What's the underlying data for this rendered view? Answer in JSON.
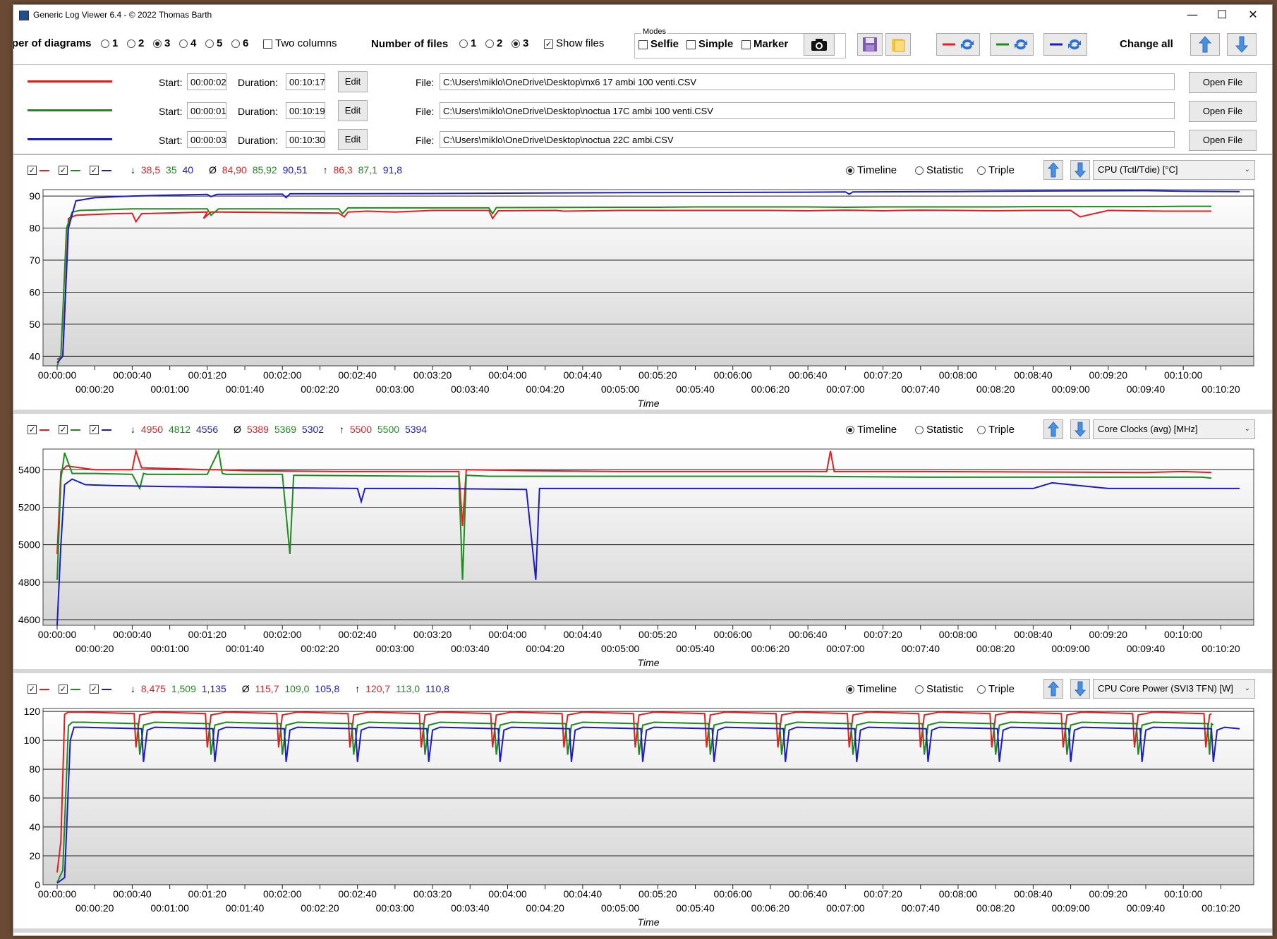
{
  "window": {
    "title": "Generic Log Viewer 6.4 - © 2022 Thomas Barth",
    "minimize": "—",
    "maximize": "☐",
    "close": "✕"
  },
  "toolbar": {
    "diagrams_label": "per of diagrams",
    "diagram_options": [
      "1",
      "2",
      "3",
      "4",
      "5",
      "6"
    ],
    "diagram_selected": "3",
    "two_columns_label": "Two columns",
    "files_label": "Number of files",
    "file_options": [
      "1",
      "2",
      "3"
    ],
    "file_selected": "3",
    "show_files_label": "Show files",
    "modes_label": "Modes",
    "selfie_label": "Selfie",
    "simple_label": "Simple",
    "marker_label": "Marker",
    "change_all_label": "Change all"
  },
  "files": [
    {
      "color": "#e02020",
      "start_label": "Start:",
      "start": "00:00:02",
      "duration_label": "Duration:",
      "duration": "00:10:17",
      "edit": "Edit",
      "file_label": "File:",
      "path": "C:\\Users\\miklo\\OneDrive\\Desktop\\mx6 17 ambi 100 venti.CSV",
      "open": "Open File"
    },
    {
      "color": "#208a20",
      "start_label": "Start:",
      "start": "00:00:01",
      "duration_label": "Duration:",
      "duration": "00:10:19",
      "edit": "Edit",
      "file_label": "File:",
      "path": "C:\\Users\\miklo\\OneDrive\\Desktop\\noctua 17C ambi 100 venti.CSV",
      "open": "Open File"
    },
    {
      "color": "#1c1cc0",
      "start_label": "Start:",
      "start": "00:00:03",
      "duration_label": "Duration:",
      "duration": "00:10:30",
      "edit": "Edit",
      "file_label": "File:",
      "path": "C:\\Users\\miklo\\OneDrive\\Desktop\\noctua 22C ambi.CSV",
      "open": "Open File"
    }
  ],
  "colors": {
    "red": "#e02020",
    "green": "#208a20",
    "blue": "#1c1cc0"
  },
  "panel_modes": [
    "Timeline",
    "Statistic",
    "Triple"
  ],
  "panels": [
    {
      "min_sym": "↓",
      "avg_sym": "Ø",
      "max_sym": "↑",
      "min": [
        "38,5",
        "35",
        "40"
      ],
      "avg": [
        "84,90",
        "85,92",
        "90,51"
      ],
      "max": [
        "86,3",
        "87,1",
        "91,8"
      ],
      "combo": "CPU (Tctl/Tdie) [°C]",
      "xlabel": "Time"
    },
    {
      "min_sym": "↓",
      "avg_sym": "Ø",
      "max_sym": "↑",
      "min": [
        "4950",
        "4812",
        "4556"
      ],
      "avg": [
        "5389",
        "5369",
        "5302"
      ],
      "max": [
        "5500",
        "5500",
        "5394"
      ],
      "combo": "Core Clocks (avg) [MHz]",
      "xlabel": "Time"
    },
    {
      "min_sym": "↓",
      "avg_sym": "Ø",
      "max_sym": "↑",
      "min": [
        "8,475",
        "1,509",
        "1,135"
      ],
      "avg": [
        "115,7",
        "109,0",
        "105,8"
      ],
      "max": [
        "120,7",
        "113,0",
        "110,8"
      ],
      "combo": "CPU Core Power (SVI3 TFN) [W]",
      "xlabel": "Time"
    }
  ],
  "chart_data": [
    {
      "type": "line",
      "ylabel": "CPU (Tctl/Tdie) [°C]",
      "yticks": [
        40,
        50,
        60,
        70,
        80,
        90
      ],
      "ylim": [
        37,
        92
      ],
      "xlim_s": [
        0,
        630
      ],
      "xticks": [
        "00:00:00",
        "00:00:20",
        "00:00:40",
        "00:01:00",
        "00:01:20",
        "00:01:40",
        "00:02:00",
        "00:02:20",
        "00:02:40",
        "00:03:00",
        "00:03:20",
        "00:03:40",
        "00:04:00",
        "00:04:20",
        "00:04:40",
        "00:05:00",
        "00:05:20",
        "00:05:40",
        "00:06:00",
        "00:06:20",
        "00:06:40",
        "00:07:00",
        "00:07:20",
        "00:07:40",
        "00:08:00",
        "00:08:20",
        "00:08:40",
        "00:09:00",
        "00:09:20",
        "00:09:40",
        "00:10:00",
        "00:10:20"
      ],
      "series": [
        {
          "color": "#e02020",
          "x": [
            0,
            3,
            6,
            10,
            30,
            40,
            42,
            45,
            80,
            78,
            82,
            85,
            150,
            153,
            155,
            165,
            180,
            200,
            230,
            232,
            235,
            266,
            270,
            300,
            340,
            380,
            400,
            420,
            430,
            440,
            460,
            480,
            500,
            520,
            540,
            545,
            560,
            590,
            600,
            615
          ],
          "y": [
            39,
            40,
            83,
            84,
            84.5,
            84.6,
            82,
            84.5,
            85,
            83,
            85,
            85,
            84.7,
            83.5,
            85,
            85.3,
            85,
            85.5,
            85.5,
            83,
            85.4,
            85.5,
            85.3,
            85.5,
            85.5,
            85.5,
            85.4,
            85.6,
            85.5,
            85.4,
            85.6,
            85.5,
            85.4,
            85.5,
            85.5,
            83.5,
            85.5,
            85.3,
            85.3,
            85.3
          ]
        },
        {
          "color": "#208a20",
          "x": [
            0,
            2,
            5,
            8,
            12,
            40,
            80,
            82,
            86,
            150,
            152,
            155,
            200,
            230,
            232,
            234,
            300,
            320,
            340,
            380,
            400,
            420,
            440,
            460,
            480,
            500,
            520,
            540,
            560,
            580,
            600,
            615
          ],
          "y": [
            35,
            40,
            80,
            85,
            85.5,
            86,
            86,
            84,
            86,
            86,
            84.5,
            86.3,
            86.3,
            86.3,
            84.5,
            86.4,
            86.5,
            86.5,
            86.6,
            86.6,
            86.6,
            86.5,
            86.6,
            86.6,
            86.6,
            86.6,
            86.7,
            86.7,
            86.7,
            86.7,
            86.8,
            86.8
          ]
        },
        {
          "color": "#1c1cc0",
          "x": [
            0,
            3,
            6,
            10,
            20,
            40,
            60,
            80,
            82,
            85,
            120,
            122,
            124,
            200,
            240,
            280,
            330,
            400,
            420,
            422,
            424,
            480,
            500,
            540,
            580,
            600,
            630
          ],
          "y": [
            38,
            40,
            80,
            88.5,
            89.5,
            90,
            90.3,
            90.5,
            89.8,
            90.5,
            90.6,
            89.5,
            90.7,
            90.8,
            90.9,
            91,
            91.1,
            91.2,
            91.3,
            90.6,
            91.3,
            91.4,
            91.5,
            91.6,
            91.7,
            91.5,
            91.4
          ]
        }
      ]
    },
    {
      "type": "line",
      "ylabel": "Core Clocks (avg) [MHz]",
      "yticks": [
        4600,
        4800,
        5000,
        5200,
        5400
      ],
      "ylim": [
        4570,
        5510
      ],
      "xlim_s": [
        0,
        630
      ],
      "xticks": [
        "00:00:00",
        "00:00:20",
        "00:00:40",
        "00:01:00",
        "00:01:20",
        "00:01:40",
        "00:02:00",
        "00:02:20",
        "00:02:40",
        "00:03:00",
        "00:03:20",
        "00:03:40",
        "00:04:00",
        "00:04:20",
        "00:04:40",
        "00:05:00",
        "00:05:20",
        "00:05:40",
        "00:06:00",
        "00:06:20",
        "00:06:40",
        "00:07:00",
        "00:07:20",
        "00:07:40",
        "00:08:00",
        "00:08:20",
        "00:08:40",
        "00:09:00",
        "00:09:20",
        "00:09:40",
        "00:10:00",
        "00:10:20"
      ],
      "series": [
        {
          "color": "#e02020",
          "x": [
            0,
            2,
            5,
            20,
            40,
            42,
            45,
            80,
            85,
            100,
            150,
            200,
            214,
            216,
            218,
            250,
            300,
            410,
            412,
            414,
            440,
            460,
            580,
            600,
            615
          ],
          "y": [
            4950,
            5390,
            5420,
            5400,
            5400,
            5500,
            5410,
            5400,
            5400,
            5395,
            5390,
            5390,
            5390,
            5100,
            5400,
            5395,
            5390,
            5390,
            5500,
            5390,
            5390,
            5390,
            5385,
            5390,
            5385
          ]
        },
        {
          "color": "#208a20",
          "x": [
            0,
            2,
            4,
            8,
            20,
            40,
            44,
            46,
            48,
            80,
            86,
            88,
            90,
            120,
            124,
            126,
            128,
            200,
            214,
            216,
            218,
            230,
            260,
            300,
            400,
            460,
            560,
            610,
            615
          ],
          "y": [
            4812,
            5350,
            5490,
            5380,
            5380,
            5375,
            5300,
            5380,
            5375,
            5375,
            5500,
            5380,
            5375,
            5375,
            4950,
            5370,
            5370,
            5365,
            5365,
            4812,
            5370,
            5365,
            5365,
            5365,
            5365,
            5360,
            5360,
            5360,
            5355
          ]
        },
        {
          "color": "#1c1cc0",
          "x": [
            0,
            2,
            4,
            8,
            15,
            30,
            60,
            100,
            160,
            162,
            164,
            200,
            250,
            255,
            257,
            259,
            300,
            400,
            480,
            520,
            530,
            560,
            600,
            630
          ],
          "y": [
            4556,
            5000,
            5320,
            5350,
            5320,
            5315,
            5310,
            5305,
            5300,
            5230,
            5300,
            5300,
            5295,
            4812,
            5300,
            5300,
            5300,
            5300,
            5300,
            5300,
            5330,
            5300,
            5300,
            5300
          ]
        }
      ]
    },
    {
      "type": "line",
      "ylabel": "CPU Core Power (SVI3 TFN) [W]",
      "yticks": [
        0,
        20,
        40,
        60,
        80,
        100,
        120
      ],
      "ylim": [
        0,
        122
      ],
      "xlim_s": [
        0,
        630
      ],
      "xticks": [
        "00:00:00",
        "00:00:20",
        "00:00:40",
        "00:01:00",
        "00:01:20",
        "00:01:40",
        "00:02:00",
        "00:02:20",
        "00:02:40",
        "00:03:00",
        "00:03:20",
        "00:03:40",
        "00:04:00",
        "00:04:20",
        "00:04:40",
        "00:05:00",
        "00:05:20",
        "00:05:40",
        "00:06:00",
        "00:06:20",
        "00:06:40",
        "00:07:00",
        "00:07:20",
        "00:07:40",
        "00:08:00",
        "00:08:20",
        "00:08:40",
        "00:09:00",
        "00:09:20",
        "00:09:40",
        "00:10:00",
        "00:10:20"
      ],
      "dip_period_s": 38,
      "series": [
        {
          "color": "#e02020",
          "base": 119.5,
          "dip": 95,
          "start": [
            0,
            2,
            4,
            6
          ],
          "start_y": [
            8.475,
            30,
            118,
            119.5
          ],
          "end_s": 615
        },
        {
          "color": "#208a20",
          "base": 112.5,
          "dip": 90,
          "start": [
            0,
            3,
            6,
            8
          ],
          "start_y": [
            1.509,
            10,
            110,
            112.5
          ],
          "end_s": 615
        },
        {
          "color": "#1c1cc0",
          "base": 109,
          "dip": 85,
          "start": [
            0,
            4,
            7,
            9
          ],
          "start_y": [
            1.135,
            5,
            100,
            109
          ],
          "end_s": 630
        }
      ]
    }
  ]
}
